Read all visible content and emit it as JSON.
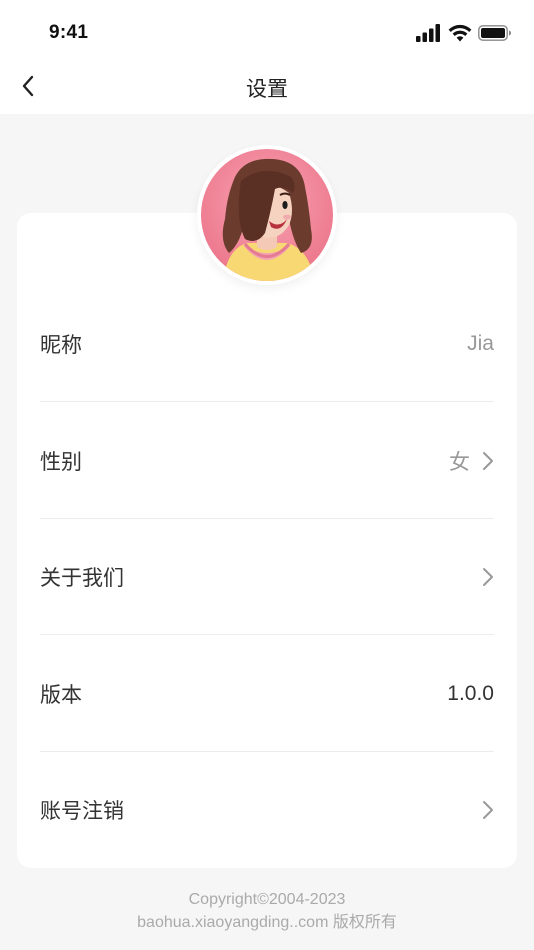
{
  "status_bar": {
    "time": "9:41",
    "icons": [
      "signal-icon",
      "wifi-icon",
      "battery-icon"
    ]
  },
  "nav": {
    "title": "设置",
    "back_icon": "chevron-left-icon"
  },
  "profile": {
    "avatar": "avatar-illustration"
  },
  "settings": {
    "nickname": {
      "label": "昵称",
      "value": "Jia"
    },
    "gender": {
      "label": "性别",
      "value": "女"
    },
    "about": {
      "label": "关于我们"
    },
    "version": {
      "label": "版本",
      "value": "1.0.0"
    },
    "cancel_account": {
      "label": "账号注销"
    }
  },
  "footer": {
    "copyright": "Copyright©2004-2023",
    "site": "baohua.xiaoyangding..com 版权所有"
  },
  "colors": {
    "background": "#f6f6f6",
    "card": "#ffffff",
    "text_primary": "#333333",
    "text_secondary": "#999999",
    "avatar_bg": "#f0889a"
  }
}
